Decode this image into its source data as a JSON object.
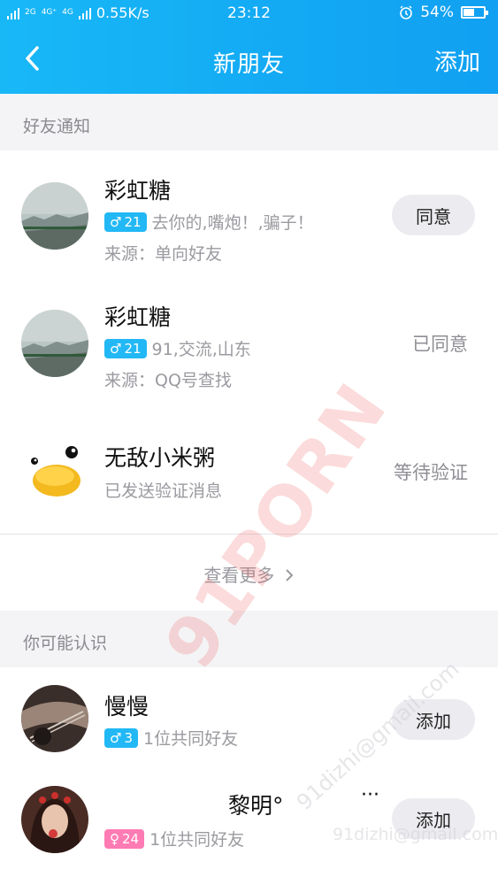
{
  "status_bar": {
    "network_1": "2G",
    "network_2": "4G⁺",
    "network_3": "4G",
    "speed": "0.55K/s",
    "time": "23:12",
    "battery_percent": "54%",
    "battery_level": 0.54
  },
  "nav": {
    "title": "新朋友",
    "add_label": "添加"
  },
  "friend_notifications": {
    "header": "好友通知",
    "items": [
      {
        "name": "彩虹糖",
        "gender": "male",
        "gender_symbol": "♂",
        "age": "21",
        "message": "去你的,嘴炮！,骗子！",
        "source": "来源：单向好友",
        "action": "同意"
      },
      {
        "name": "彩虹糖",
        "gender": "male",
        "gender_symbol": "♂",
        "age": "21",
        "message": "91,交流,山东",
        "source": "来源：QQ号查找",
        "status": "已同意"
      },
      {
        "name": "无敌小米粥",
        "message": "已发送验证消息",
        "status": "等待验证"
      }
    ],
    "see_more": "查看更多"
  },
  "may_know": {
    "header": "你可能认识",
    "items": [
      {
        "name": "慢慢",
        "gender": "male",
        "gender_symbol": "♂",
        "age": "3",
        "mutual": "1位共同好友",
        "action": "添加"
      },
      {
        "name": "黎明°",
        "extra": "···",
        "gender": "female",
        "gender_symbol": "♀",
        "age": "24",
        "mutual": "1位共同好友",
        "action": "添加"
      }
    ]
  },
  "watermark": {
    "main": "91PORN",
    "sub": "91dizhi@gmail.com"
  },
  "colors": {
    "header_blue": "#18b8f7",
    "male_badge": "#22b8f5",
    "female_badge": "#ff7bb4"
  }
}
